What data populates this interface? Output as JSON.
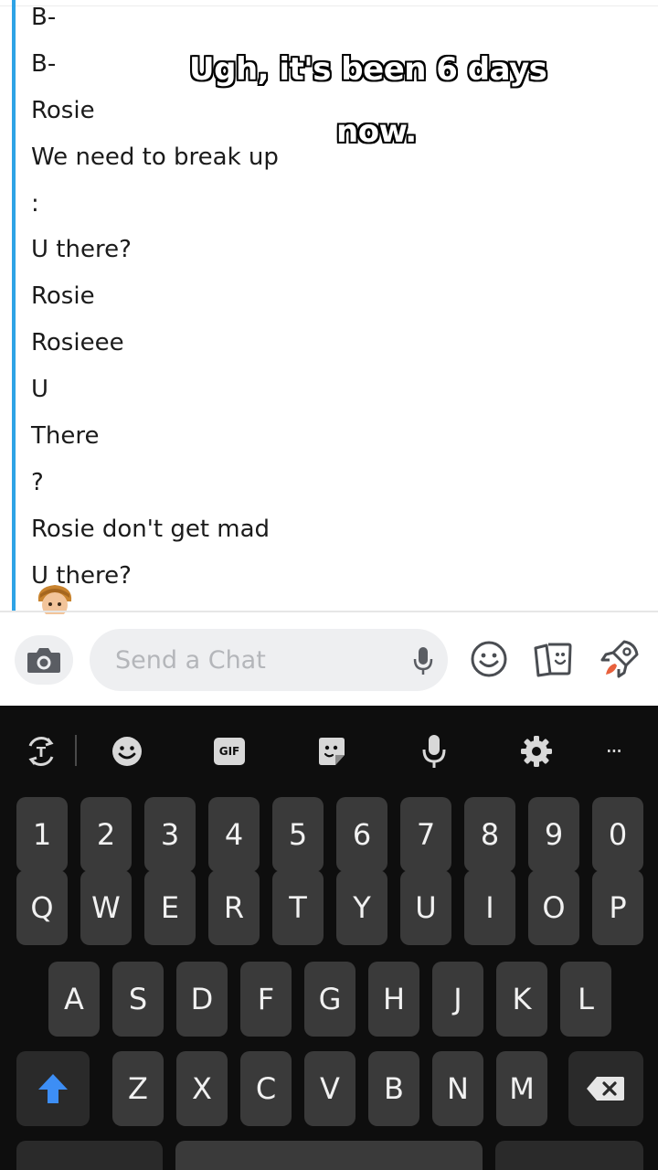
{
  "chat": {
    "messages": [
      "B-",
      "B-",
      "Rosie",
      "We need to break up",
      ":",
      "U there?",
      "Rosie",
      "Rosieee",
      "U",
      "There",
      "?",
      " Rosie don't get mad",
      "U there?"
    ]
  },
  "caption": {
    "line1": "Ugh, it's been 6 days",
    "line2": "now."
  },
  "input_bar": {
    "placeholder": "Send a Chat",
    "icons": [
      "camera-icon",
      "microphone-icon",
      "smiley-icon",
      "cards-icon",
      "rocket-icon"
    ]
  },
  "keyboard": {
    "toolbar": [
      "text-translate-icon",
      "emoji-icon",
      "gif-icon",
      "sticker-icon",
      "voice-input-icon",
      "settings-icon",
      "more-icon"
    ],
    "gif_label": "GIF",
    "more_label": "···",
    "rows": {
      "numbers": [
        "1",
        "2",
        "3",
        "4",
        "5",
        "6",
        "7",
        "8",
        "9",
        "0"
      ],
      "top": [
        "Q",
        "W",
        "E",
        "R",
        "T",
        "Y",
        "U",
        "I",
        "O",
        "P"
      ],
      "middle": [
        "A",
        "S",
        "D",
        "F",
        "G",
        "H",
        "J",
        "K",
        "L"
      ],
      "bottom": [
        "Z",
        "X",
        "C",
        "V",
        "B",
        "N",
        "M"
      ]
    },
    "shift_color": "#3d8ef5",
    "accent_blue": "#2ea3e6"
  }
}
